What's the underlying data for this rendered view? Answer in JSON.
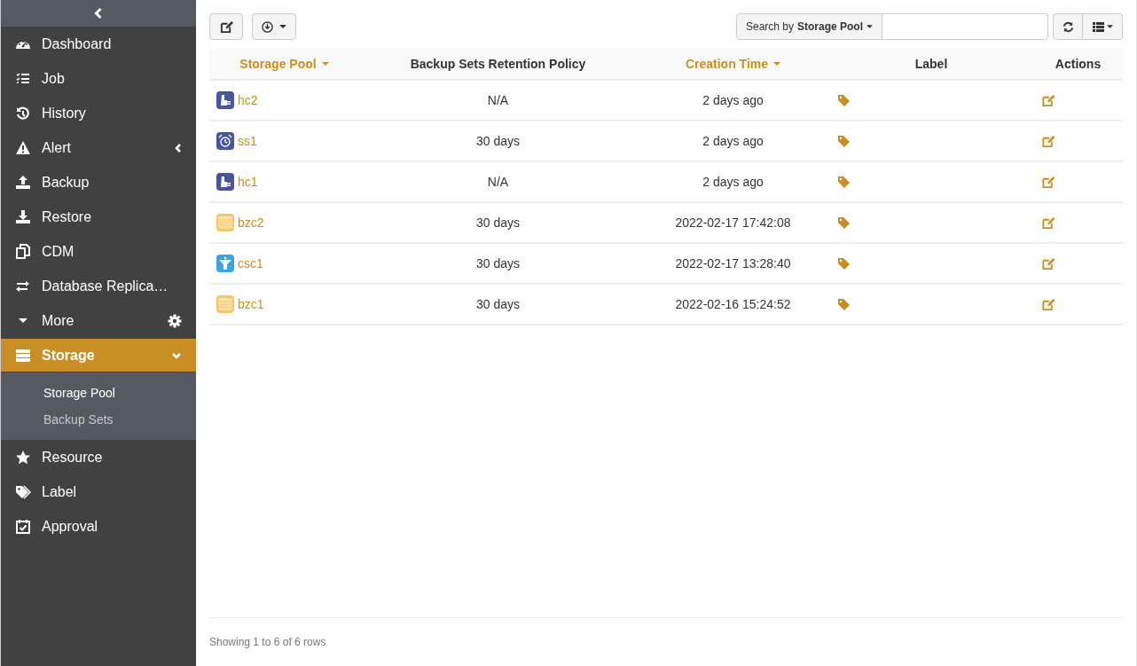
{
  "sidebar": {
    "items": [
      {
        "label": "Dashboard",
        "selected": false
      },
      {
        "label": "Job",
        "selected": false
      },
      {
        "label": "History",
        "selected": false
      },
      {
        "label": "Alert",
        "selected": false,
        "expanded": false
      },
      {
        "label": "Backup",
        "selected": false
      },
      {
        "label": "Restore",
        "selected": false
      },
      {
        "label": "CDM",
        "selected": false
      },
      {
        "label": "Database Replica…",
        "selected": false
      },
      {
        "label": "More",
        "selected": false
      },
      {
        "label": "Storage",
        "selected": true,
        "expanded": true,
        "children": [
          {
            "label": "Storage Pool",
            "selected": true
          },
          {
            "label": "Backup Sets",
            "selected": false
          }
        ]
      },
      {
        "label": "Resource",
        "selected": false
      },
      {
        "label": "Label",
        "selected": false
      },
      {
        "label": "Approval",
        "selected": false
      }
    ]
  },
  "toolbar": {
    "search_by": {
      "prefix": "Search by",
      "field": "Storage Pool"
    }
  },
  "table": {
    "columns": [
      {
        "label": "Storage Pool",
        "sortable": true
      },
      {
        "label": "Backup Sets Retention Policy",
        "sortable": false
      },
      {
        "label": "Creation Time",
        "sortable": true
      },
      {
        "label": "Label",
        "sortable": false
      },
      {
        "label": "Actions",
        "sortable": false
      }
    ],
    "rows": [
      {
        "kind": "hc",
        "name": "hc2",
        "retention": "N/A",
        "created": "2 days ago"
      },
      {
        "kind": "ss",
        "name": "ss1",
        "retention": "30 days",
        "created": "2 days ago"
      },
      {
        "kind": "hc",
        "name": "hc1",
        "retention": "N/A",
        "created": "2 days ago"
      },
      {
        "kind": "bzc",
        "name": "bzc2",
        "retention": "30 days",
        "created": "2022-02-17 17:42:08"
      },
      {
        "kind": "csc",
        "name": "csc1",
        "retention": "30 days",
        "created": "2022-02-17 13:28:40"
      },
      {
        "kind": "bzc",
        "name": "bzc1",
        "retention": "30 days",
        "created": "2022-02-16 15:24:52"
      }
    ]
  },
  "footer": "Showing 1 to 6 of 6 rows"
}
